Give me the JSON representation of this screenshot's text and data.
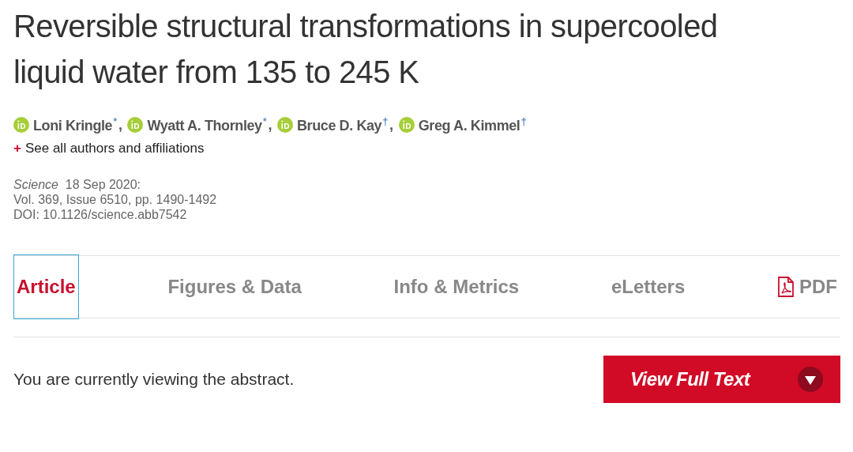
{
  "title": "Reversible structural transformations in supercooled liquid water from 135 to 245 K",
  "authors": [
    {
      "name": "Loni Kringle",
      "mark": "*",
      "separator": ","
    },
    {
      "name": "Wyatt A. Thornley",
      "mark": "*",
      "separator": ","
    },
    {
      "name": "Bruce D. Kay",
      "mark": "†",
      "separator": ","
    },
    {
      "name": "Greg A. Kimmel",
      "mark": "†"
    }
  ],
  "affiliations_link": {
    "icon": "+",
    "label": "See all authors and affiliations"
  },
  "citation": {
    "journal": "Science",
    "date": "18 Sep 2020:",
    "volume": "Vol. 369, Issue 6510, pp. 1490-1492",
    "doi": "DOI: 10.1126/science.abb7542"
  },
  "tabs": [
    {
      "label": "Article",
      "selected": true,
      "kind": "text"
    },
    {
      "label": "Figures & Data",
      "selected": false,
      "kind": "text"
    },
    {
      "label": "Info & Metrics",
      "selected": false,
      "kind": "text"
    },
    {
      "label": "eLetters",
      "selected": false,
      "kind": "text"
    },
    {
      "label": "PDF",
      "selected": false,
      "kind": "pdf"
    }
  ],
  "notice": "You are currently viewing the abstract.",
  "full_text_button": {
    "label": "View Full Text"
  }
}
